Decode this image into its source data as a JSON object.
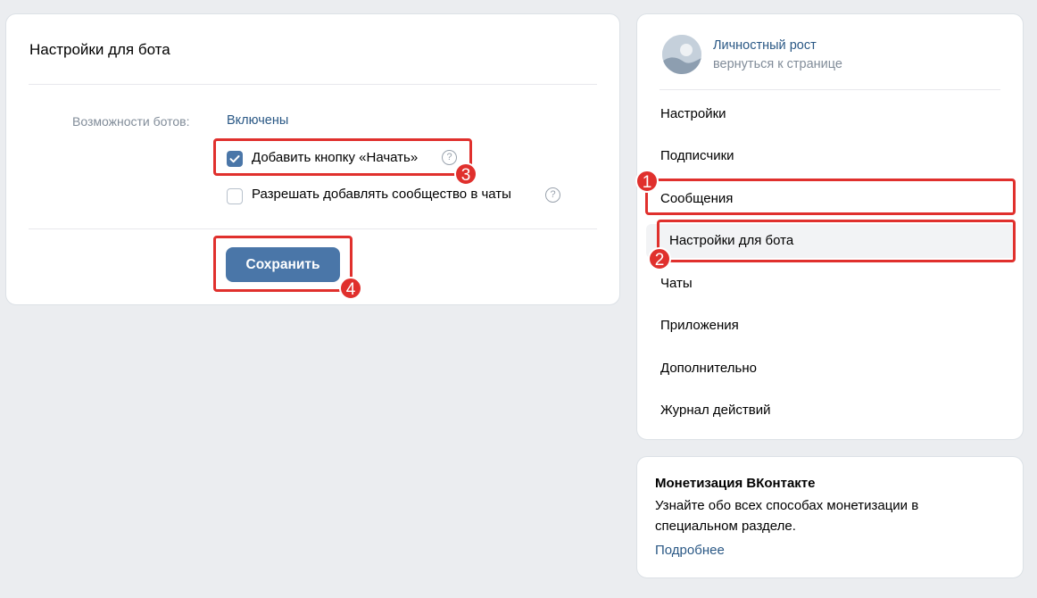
{
  "main": {
    "title": "Настройки для бота",
    "bots_label": "Возможности ботов:",
    "bots_value": "Включены",
    "options": [
      {
        "label": "Добавить кнопку «Начать»",
        "checked": true
      },
      {
        "label": "Разрешать добавлять сообщество в чаты",
        "checked": false
      }
    ],
    "save_label": "Сохранить",
    "help_glyph": "?"
  },
  "sidebar": {
    "group_name": "Личностный рост",
    "back_link": "вернуться к странице",
    "items": [
      {
        "label": "Настройки"
      },
      {
        "label": "Подписчики"
      },
      {
        "label": "Сообщения"
      },
      {
        "label": "Настройки для бота"
      },
      {
        "label": "Чаты"
      },
      {
        "label": "Приложения"
      },
      {
        "label": "Дополнительно"
      },
      {
        "label": "Журнал действий"
      }
    ]
  },
  "promo": {
    "title": "Монетизация ВКонтакте",
    "text": "Узнайте обо всех способах монетизации в специальном разделе.",
    "link": "Подробнее"
  },
  "annotations": {
    "badges": [
      "1",
      "2",
      "3",
      "4"
    ],
    "color": "#e0302d"
  },
  "colors": {
    "accent": "#4a76a8",
    "link": "#2a5885",
    "muted": "#818c99",
    "background": "#ebedf0"
  }
}
